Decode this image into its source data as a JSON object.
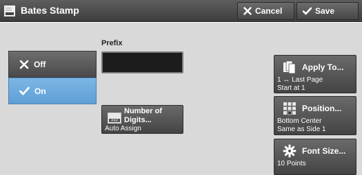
{
  "window": {
    "title": "Bates Stamp"
  },
  "toolbar": {
    "cancel_label": "Cancel",
    "save_label": "Save"
  },
  "prefix": {
    "label": "Prefix",
    "value": ""
  },
  "stamp_options": [
    {
      "label": "Off",
      "selected": false
    },
    {
      "label": "On",
      "selected": true
    }
  ],
  "number_of_digits": {
    "line1": "Number of",
    "line2": "Digits...",
    "value": "Auto Assign"
  },
  "apply_to": {
    "title": "Apply To...",
    "line1": "1 ↔ Last Page",
    "line2": "Start at 1"
  },
  "position": {
    "title": "Position...",
    "line1": "Bottom Center",
    "line2": "Same as Side 1"
  },
  "font_size": {
    "title": "Font Size...",
    "line1": "10 Points"
  },
  "colors": {
    "selected": "#6aa8dc",
    "button_dark": "#555555",
    "panel_bg": "#d9d9d9"
  }
}
